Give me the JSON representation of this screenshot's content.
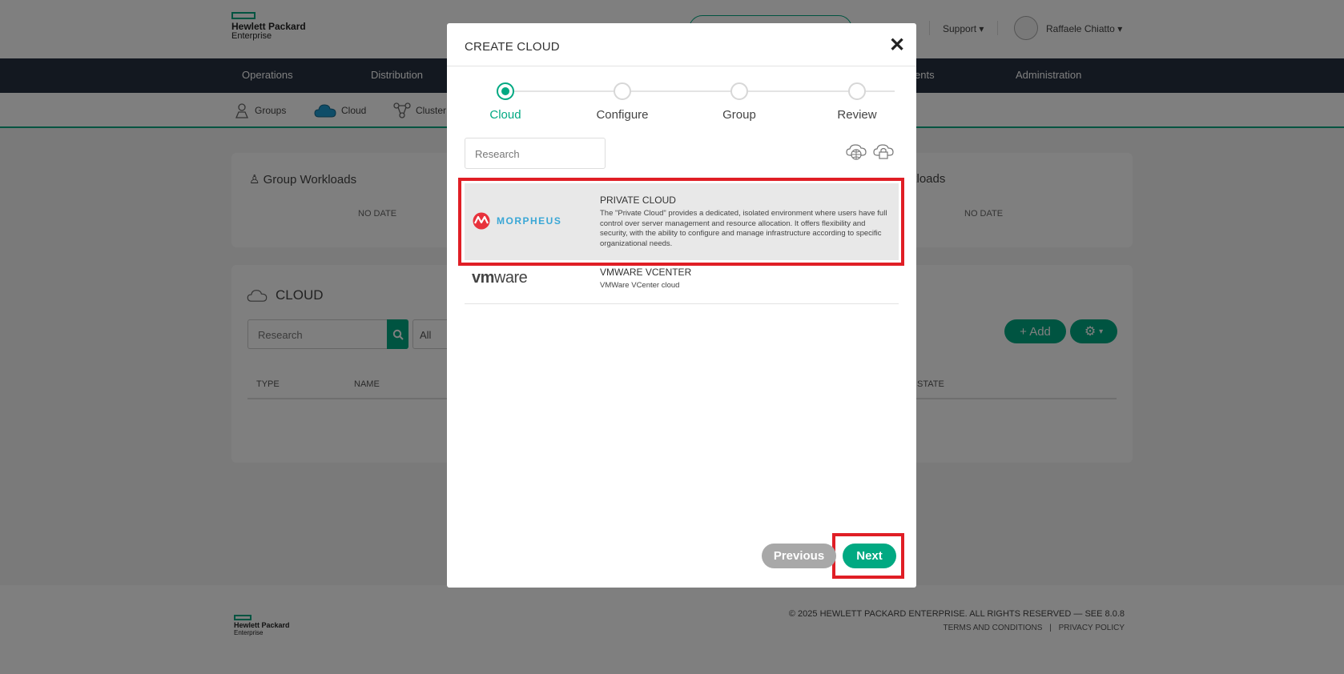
{
  "header": {
    "logo_line1": "Hewlett Packard",
    "logo_line2": "Enterprise",
    "support_label": "Support",
    "user_name": "Raffaele Chiatto"
  },
  "nav": {
    "items": [
      "Operations",
      "Distribution",
      "ents",
      "Administration"
    ]
  },
  "subnav": {
    "groups": "Groups",
    "cloud": "Cloud",
    "cluster": "Cluster"
  },
  "cards": {
    "group_workloads": "Group Workloads",
    "right_workloads": "rkloads",
    "no_date": "NO DATE"
  },
  "cloud_panel": {
    "title": "CLOUD",
    "search_placeholder": "Research",
    "filter_value": "All",
    "add_label": "+ Add",
    "col_type": "TYPE",
    "col_name": "NAME",
    "col_state": "STATE"
  },
  "footer": {
    "logo_line1": "Hewlett Packard",
    "logo_line2": "Enterprise",
    "copyright": "© 2025 HEWLETT PACKARD ENTERPRISE. ALL RIGHTS RESERVED — SEE 8.0.8",
    "terms": "TERMS AND CONDITIONS",
    "divider": "|",
    "privacy": "PRIVACY POLICY"
  },
  "modal": {
    "title": "CREATE CLOUD",
    "steps": [
      "Cloud",
      "Configure",
      "Group",
      "Review"
    ],
    "search_placeholder": "Research",
    "options": [
      {
        "logo": "MORPHEUS",
        "name": "PRIVATE CLOUD",
        "description": "The \"Private Cloud\" provides a dedicated, isolated environment where users have full control over server management and resource allocation. It offers flexibility and security, with the ability to configure and manage infrastructure according to specific organizational needs."
      },
      {
        "logo_a": "vm",
        "logo_b": "ware",
        "name": "VMWARE VCENTER",
        "description": "VMWare VCenter cloud"
      }
    ],
    "previous_label": "Previous",
    "next_label": "Next"
  },
  "colors": {
    "accent": "#01a982",
    "nav_bg": "#263040",
    "highlight": "#e01e25"
  }
}
